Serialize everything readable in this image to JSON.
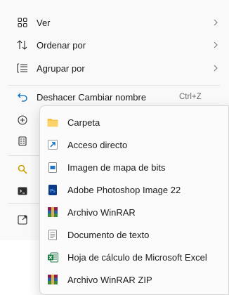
{
  "main_menu": {
    "items": [
      {
        "label": "Ver",
        "icon": "view-grid-icon",
        "has_submenu": true
      },
      {
        "label": "Ordenar por",
        "icon": "sort-arrows-icon",
        "has_submenu": true
      },
      {
        "label": "Agrupar por",
        "icon": "group-list-icon",
        "has_submenu": true
      },
      {
        "label": "Deshacer Cambiar nombre",
        "icon": "undo-icon",
        "accelerator": "Ctrl+Z"
      }
    ]
  },
  "submenu": {
    "items": [
      {
        "label": "Carpeta",
        "icon": "folder-icon"
      },
      {
        "label": "Acceso directo",
        "icon": "shortcut-icon"
      },
      {
        "label": "Imagen de mapa de bits",
        "icon": "bitmap-image-icon"
      },
      {
        "label": "Adobe Photoshop Image 22",
        "icon": "photoshop-icon"
      },
      {
        "label": "Archivo WinRAR",
        "icon": "winrar-icon"
      },
      {
        "label": "Documento de texto",
        "icon": "text-document-icon"
      },
      {
        "label": "Hoja de cálculo de Microsoft Excel",
        "icon": "excel-icon"
      },
      {
        "label": "Archivo WinRAR ZIP",
        "icon": "winrar-zip-icon"
      }
    ]
  },
  "colors": {
    "accent": "#0067c0",
    "folder": "#f4c04a",
    "photoshop": "#0b3a8a",
    "excel": "#1d7a45",
    "winrar": "#8b1a4a"
  }
}
